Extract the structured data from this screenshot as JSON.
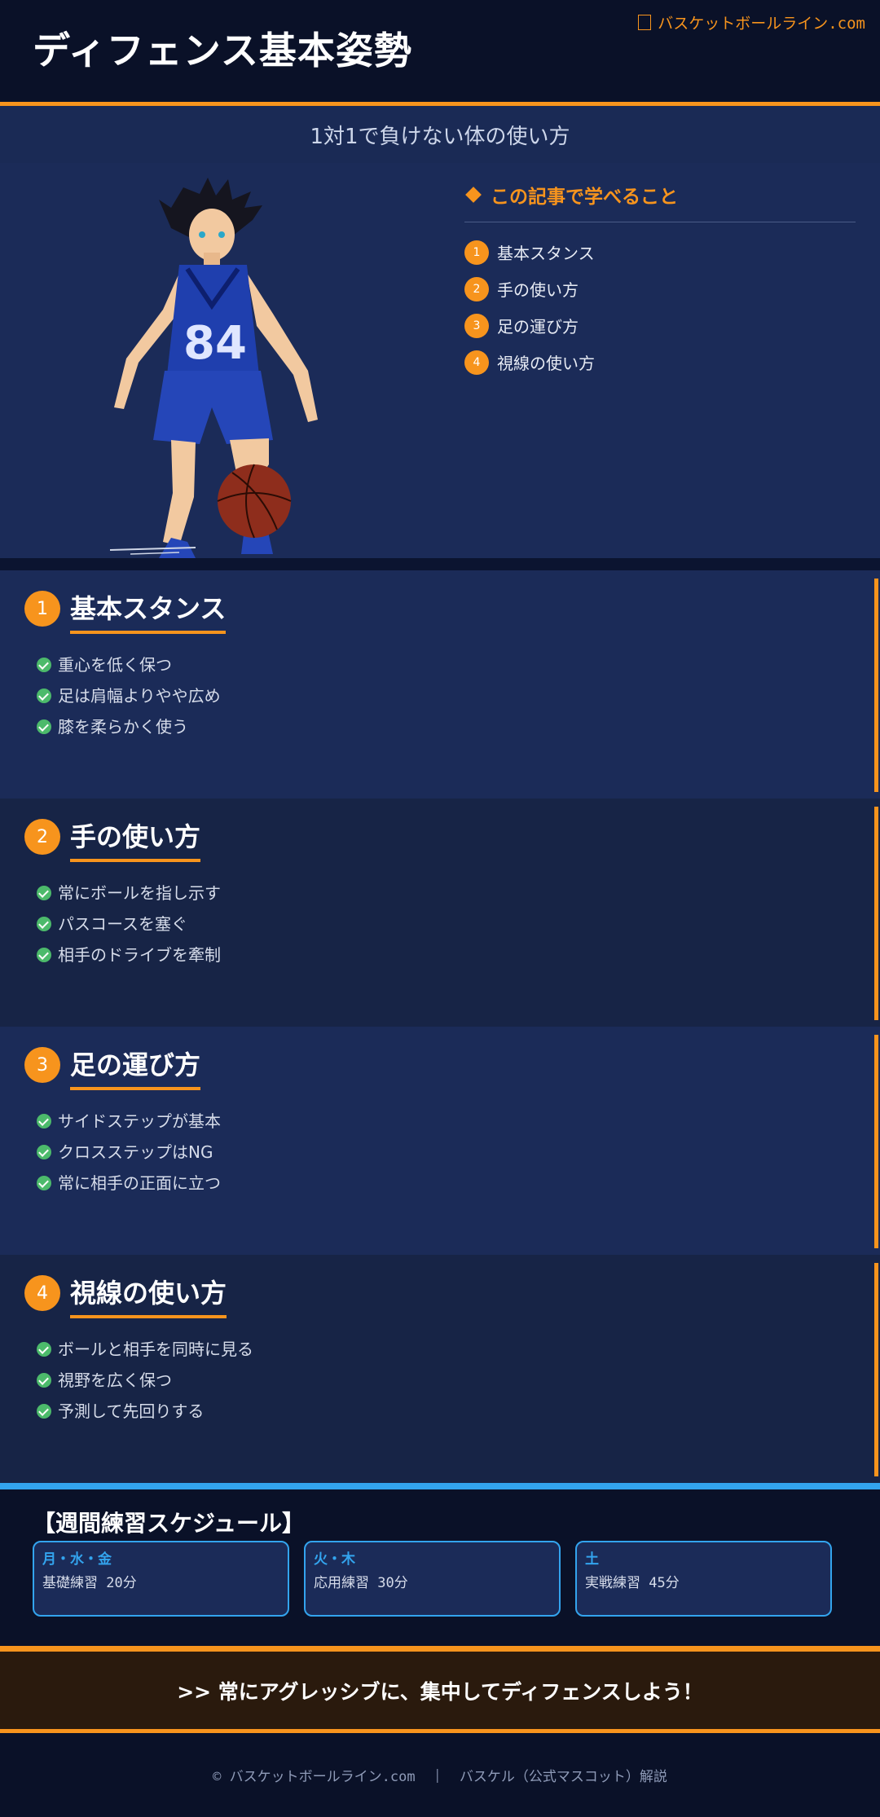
{
  "header": {
    "title": "ディフェンス基本姿勢",
    "brand": "バスケットボールライン.com"
  },
  "subtitle": "1対1で負けない体の使い方",
  "toc": {
    "title": "この記事で学べること",
    "items": [
      {
        "num": "1",
        "label": "基本スタンス"
      },
      {
        "num": "2",
        "label": "手の使い方"
      },
      {
        "num": "3",
        "label": "足の運び方"
      },
      {
        "num": "4",
        "label": "視線の使い方"
      }
    ]
  },
  "sections": [
    {
      "num": "1",
      "title": "基本スタンス",
      "points": [
        "重心を低く保つ",
        "足は肩幅よりやや広め",
        "膝を柔らかく使う"
      ]
    },
    {
      "num": "2",
      "title": "手の使い方",
      "points": [
        "常にボールを指し示す",
        "パスコースを塞ぐ",
        "相手のドライブを牽制"
      ]
    },
    {
      "num": "3",
      "title": "足の運び方",
      "points": [
        "サイドステップが基本",
        "クロスステップはNG",
        "常に相手の正面に立つ"
      ]
    },
    {
      "num": "4",
      "title": "視線の使い方",
      "points": [
        "ボールと相手を同時に見る",
        "視野を広く保つ",
        "予測して先回りする"
      ]
    }
  ],
  "schedule": {
    "title": "【週間練習スケジュール】",
    "cards": [
      {
        "day": "月・水・金",
        "desc": "基礎練習 20分"
      },
      {
        "day": "火・木",
        "desc": "応用練習 30分"
      },
      {
        "day": "土",
        "desc": "実戦練習 45分"
      }
    ]
  },
  "cta": ">> 常にアグレッシブに、集中してディフェンスしよう！",
  "footer": {
    "copyright": "© バスケットボールライン.com",
    "separator": "|",
    "credit": "バスケル（公式マスコット）解説"
  },
  "colors": {
    "accent": "#f7941d",
    "blue_accent": "#33a4ee",
    "check": "#4cba6b",
    "background": "#0a1128",
    "panel": "#1b2b58"
  }
}
